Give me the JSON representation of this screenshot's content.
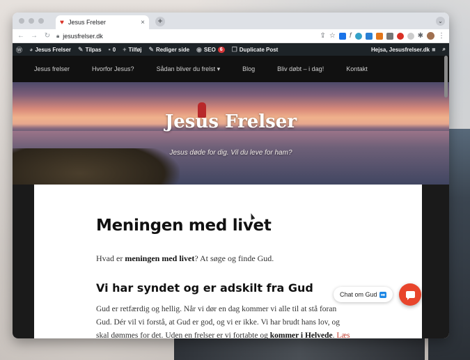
{
  "browser": {
    "tab_title": "Jesus Frelser",
    "url": "jesusfrelser.dk",
    "new_tab_symbol": "+",
    "tab_close_symbol": "×"
  },
  "adminbar": {
    "site_name": "Jesus Frelser",
    "customize": "Tilpas",
    "comments_count": "0",
    "new": "Tilføj",
    "edit_page": "Rediger side",
    "seo": "SEO",
    "seo_count": "6",
    "duplicate": "Duplicate Post",
    "greeting": "Hejsa, Jesusfrelser.dk"
  },
  "nav": {
    "items": [
      {
        "label": "Jesus frelser"
      },
      {
        "label": "Hvorfor Jesus?"
      },
      {
        "label": "Sådan bliver du frelst ▾"
      },
      {
        "label": "Blog"
      },
      {
        "label": "Bliv døbt – i dag!"
      },
      {
        "label": "Kontakt"
      }
    ]
  },
  "hero": {
    "title": "Jesus Frelser",
    "subtitle": "Jesus døde for dig. Vil du leve for ham?"
  },
  "article": {
    "title": "Meningen med livet",
    "intro_pre": "Hvad er ",
    "intro_bold": "meningen med livet",
    "intro_post": "? At søge og finde Gud.",
    "heading": "Vi har syndet og er adskilt fra Gud",
    "body_1": "Gud er retfærdig og hellig. Når vi dør en dag kommer vi alle til at stå foran Gud. Dér vil vi forstå, at Gud er god, og vi er ikke. Vi har brudt hans lov, og skal dømmes for det. Uden en frelser er vi fortabte og ",
    "body_bold": "kommer i Helvede",
    "body_2": ". ",
    "body_link": "Læs mere"
  },
  "chat": {
    "label": "Chat om Gud",
    "arrow": "➡"
  },
  "colors": {
    "admin_bg": "#1d2327",
    "nav_bg": "#111111",
    "chat_accent": "#e8452c",
    "link": "#c0392b"
  }
}
